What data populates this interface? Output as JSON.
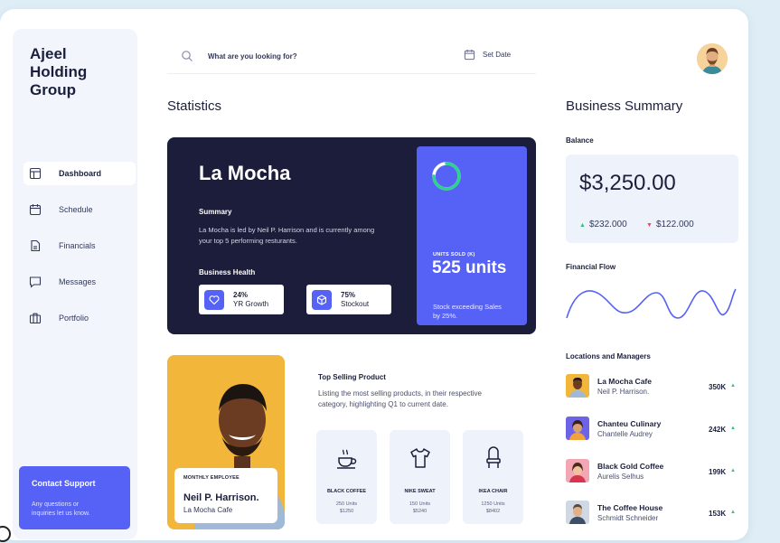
{
  "brand": "Ajeel Holding Group",
  "sidebar": {
    "items": [
      {
        "label": "Dashboard",
        "icon": "layout-icon"
      },
      {
        "label": "Schedule",
        "icon": "calendar-icon"
      },
      {
        "label": "Financials",
        "icon": "document-icon"
      },
      {
        "label": "Messages",
        "icon": "chat-icon"
      },
      {
        "label": "Portfolio",
        "icon": "briefcase-icon"
      }
    ],
    "support": {
      "title": "Contact Support",
      "subtitle": "Any questions or inquiries let us know."
    }
  },
  "header": {
    "search_placeholder": "What are you looking for?",
    "set_date": "Set Date"
  },
  "statistics": {
    "title": "Statistics",
    "card": {
      "name": "La Mocha",
      "summary_title": "Summary",
      "summary_text": "La Mocha is led by Neil P. Harrison and is currently among your top 5 performing resturants.",
      "business_health_title": "Business Health",
      "growth_value": "24%",
      "growth_label": "YR Growth",
      "stockout_value": "75%",
      "stockout_label": "Stockout",
      "units_label": "UNITS SOLD (K)",
      "units_value": "525 units",
      "units_desc": "Stock exceeding Sales by 25%.",
      "ring_progress": 0.75
    }
  },
  "employee": {
    "label": "MONTHLY EMPLOYEE",
    "name": "Neil P. Harrison.",
    "place": "La Mocha Cafe"
  },
  "top_selling": {
    "title": "Top Selling Product",
    "description": "Listing the most selling products, in their respective category, highlighting Q1 to current date.",
    "products": [
      {
        "name": "BLACK COFFEE",
        "units": "250 Units",
        "price": "$1250",
        "icon": "coffee-cup-icon"
      },
      {
        "name": "NIKE SWEAT",
        "units": "150 Units",
        "price": "$5240",
        "icon": "tshirt-icon"
      },
      {
        "name": "IKEA CHAIR",
        "units": "1250 Units",
        "price": "$8402",
        "icon": "chair-icon"
      }
    ]
  },
  "business_summary": {
    "title": "Business Summary",
    "balance_title": "Balance",
    "balance_value": "$3,250.00",
    "income": "$232.000",
    "expense": "$122.000",
    "financial_flow_title": "Financial Flow",
    "locations_title": "Locations and Managers",
    "locations": [
      {
        "name": "La Mocha Cafe",
        "manager": "Neil P. Harrison.",
        "value": "350K"
      },
      {
        "name": "Chanteu Culinary",
        "manager": "Chantelle Audrey",
        "value": "242K"
      },
      {
        "name": "Black Gold Coffee",
        "manager": "Aurelis Selhus",
        "value": "199K"
      },
      {
        "name": "The Coffee House",
        "manager": "Schmidt Schneider",
        "value": "153K"
      }
    ]
  },
  "colors": {
    "accent": "#5662f6",
    "dark": "#1b1d3a",
    "up": "#2fbf8a",
    "down": "#f0476b",
    "employee_bg": "#f2b63a"
  }
}
